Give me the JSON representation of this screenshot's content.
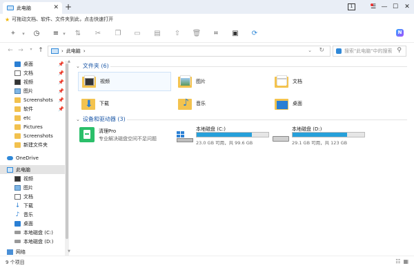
{
  "tab": {
    "title": "此电脑",
    "close": "✕"
  },
  "new_tab": "+",
  "window": {
    "tab_count": "1",
    "minimize": "—",
    "maximize": "☐",
    "close": "✕"
  },
  "bookmark_bar": {
    "text": "可拖动文档、软件、文件夹到此，点击快速打开"
  },
  "address": {
    "path": "此电脑",
    "separator": "›"
  },
  "search": {
    "placeholder": "搜索\"此电脑\"中的搜索"
  },
  "sidebar": {
    "quick": [
      {
        "label": "桌面",
        "icon": "desktop-icon",
        "pinned": true
      },
      {
        "label": "文档",
        "icon": "document-icon",
        "pinned": true
      },
      {
        "label": "视频",
        "icon": "video-icon",
        "pinned": true
      },
      {
        "label": "图片",
        "icon": "picture-icon",
        "pinned": true
      },
      {
        "label": "Screenshots",
        "icon": "folder-icon",
        "pinned": true
      },
      {
        "label": "软件",
        "icon": "folder-icon",
        "pinned": true
      },
      {
        "label": "etc",
        "icon": "folder-icon",
        "pinned": false
      },
      {
        "label": "Pictures",
        "icon": "folder-icon",
        "pinned": false
      },
      {
        "label": "Screenshots",
        "icon": "folder-icon",
        "pinned": false
      },
      {
        "label": "新建文件夹",
        "icon": "folder-icon",
        "pinned": false
      }
    ],
    "onedrive": "OneDrive",
    "thispc": "此电脑",
    "pc_items": [
      {
        "label": "视频",
        "icon": "video-icon"
      },
      {
        "label": "图片",
        "icon": "picture-icon"
      },
      {
        "label": "文档",
        "icon": "document-icon"
      },
      {
        "label": "下载",
        "icon": "download-icon"
      },
      {
        "label": "音乐",
        "icon": "music-icon"
      },
      {
        "label": "桌面",
        "icon": "desktop-icon"
      },
      {
        "label": "本地磁盘 (C:)",
        "icon": "drive-icon"
      },
      {
        "label": "本地磁盘 (D:)",
        "icon": "drive-icon"
      }
    ],
    "network": "网络"
  },
  "main": {
    "folders_header": "文件夹 (6)",
    "folders": [
      {
        "label": "视频",
        "icon": "video-folder-icon"
      },
      {
        "label": "图片",
        "icon": "picture-folder-icon"
      },
      {
        "label": "文档",
        "icon": "document-folder-icon"
      },
      {
        "label": "下载",
        "icon": "download-folder-icon"
      },
      {
        "label": "音乐",
        "icon": "music-folder-icon"
      },
      {
        "label": "桌面",
        "icon": "desktop-folder-icon"
      }
    ],
    "devices_header": "设备和驱动器 (3)",
    "app": {
      "name": "清理Pro",
      "desc": "专业解决磁盘空间不足问题",
      "color": "#2bbf6a"
    },
    "drives": [
      {
        "name": "本地磁盘 (C:)",
        "capacity": "23.0 GB 可用，共 99.6 GB",
        "used_fraction": 0.77
      },
      {
        "name": "本地磁盘 (D:)",
        "capacity": "29.1 GB 可用，共 123 GB",
        "used_fraction": 0.76
      }
    ]
  },
  "status": {
    "count": "9 个项目"
  },
  "colors": {
    "accent": "#1f5aa8",
    "drive_fill": "#26a0da",
    "folder": "#f3c34f"
  }
}
